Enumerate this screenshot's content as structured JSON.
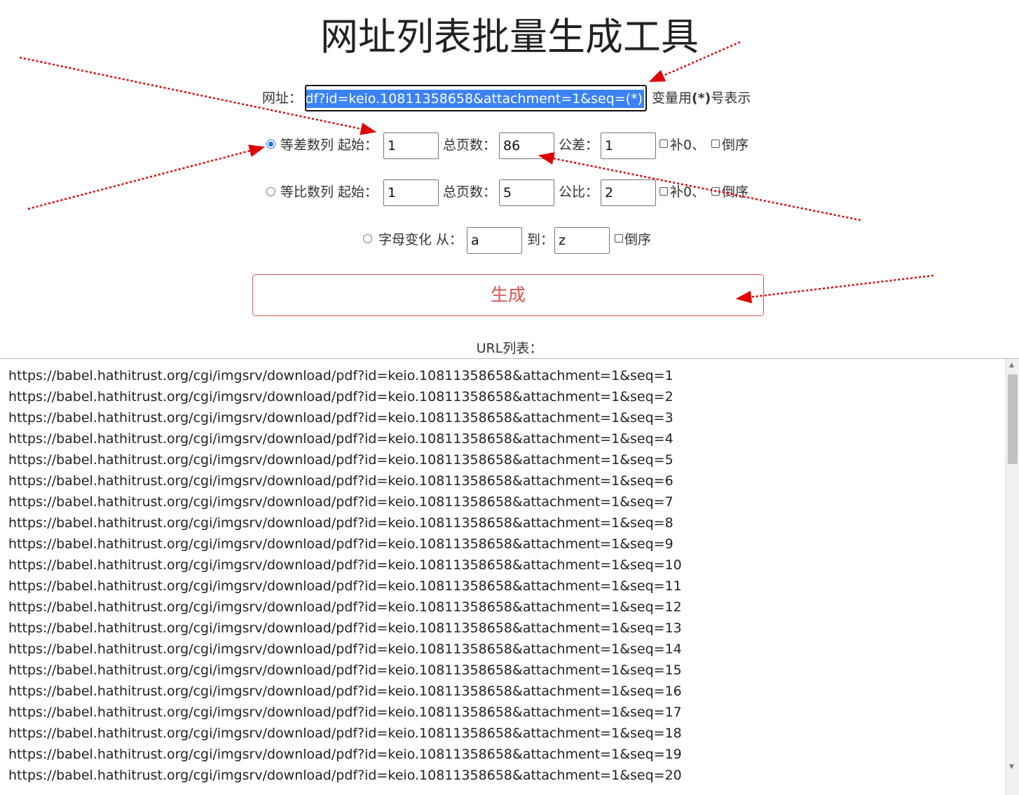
{
  "title": "网址列表批量生成工具",
  "url_row": {
    "label": "网址：",
    "value_visible": "df?id=keio.10811358658&attachment=1&seq=(*)",
    "hint_prefix": "变量用",
    "hint_star": "(*)",
    "hint_suffix": "号表示"
  },
  "arithmetic": {
    "selected": true,
    "label": "等差数列 起始：",
    "start": "1",
    "total_label": "总页数：",
    "total": "86",
    "step_label": "公差：",
    "step": "1",
    "pad_label": "补0、",
    "reverse_label": "倒序"
  },
  "geometric": {
    "selected": false,
    "label": "等比数列 起始：",
    "start": "1",
    "total_label": "总页数：",
    "total": "5",
    "ratio_label": "公比：",
    "ratio": "2",
    "pad_label": "补0、",
    "reverse_label": "倒序"
  },
  "letters": {
    "selected": false,
    "label": "字母变化 从：",
    "from": "a",
    "to_label": "到：",
    "to": "z",
    "reverse_label": "倒序"
  },
  "generate_label": "生成",
  "list_label": "URL列表：",
  "urls": [
    "https://babel.hathitrust.org/cgi/imgsrv/download/pdf?id=keio.10811358658&attachment=1&seq=1",
    "https://babel.hathitrust.org/cgi/imgsrv/download/pdf?id=keio.10811358658&attachment=1&seq=2",
    "https://babel.hathitrust.org/cgi/imgsrv/download/pdf?id=keio.10811358658&attachment=1&seq=3",
    "https://babel.hathitrust.org/cgi/imgsrv/download/pdf?id=keio.10811358658&attachment=1&seq=4",
    "https://babel.hathitrust.org/cgi/imgsrv/download/pdf?id=keio.10811358658&attachment=1&seq=5",
    "https://babel.hathitrust.org/cgi/imgsrv/download/pdf?id=keio.10811358658&attachment=1&seq=6",
    "https://babel.hathitrust.org/cgi/imgsrv/download/pdf?id=keio.10811358658&attachment=1&seq=7",
    "https://babel.hathitrust.org/cgi/imgsrv/download/pdf?id=keio.10811358658&attachment=1&seq=8",
    "https://babel.hathitrust.org/cgi/imgsrv/download/pdf?id=keio.10811358658&attachment=1&seq=9",
    "https://babel.hathitrust.org/cgi/imgsrv/download/pdf?id=keio.10811358658&attachment=1&seq=10",
    "https://babel.hathitrust.org/cgi/imgsrv/download/pdf?id=keio.10811358658&attachment=1&seq=11",
    "https://babel.hathitrust.org/cgi/imgsrv/download/pdf?id=keio.10811358658&attachment=1&seq=12",
    "https://babel.hathitrust.org/cgi/imgsrv/download/pdf?id=keio.10811358658&attachment=1&seq=13",
    "https://babel.hathitrust.org/cgi/imgsrv/download/pdf?id=keio.10811358658&attachment=1&seq=14",
    "https://babel.hathitrust.org/cgi/imgsrv/download/pdf?id=keio.10811358658&attachment=1&seq=15",
    "https://babel.hathitrust.org/cgi/imgsrv/download/pdf?id=keio.10811358658&attachment=1&seq=16",
    "https://babel.hathitrust.org/cgi/imgsrv/download/pdf?id=keio.10811358658&attachment=1&seq=17",
    "https://babel.hathitrust.org/cgi/imgsrv/download/pdf?id=keio.10811358658&attachment=1&seq=18",
    "https://babel.hathitrust.org/cgi/imgsrv/download/pdf?id=keio.10811358658&attachment=1&seq=19",
    "https://babel.hathitrust.org/cgi/imgsrv/download/pdf?id=keio.10811358658&attachment=1&seq=20"
  ],
  "colors": {
    "accent_red": "#d9534f",
    "selection_blue": "#3b82f6",
    "annotation_arrow": "#e00000"
  }
}
